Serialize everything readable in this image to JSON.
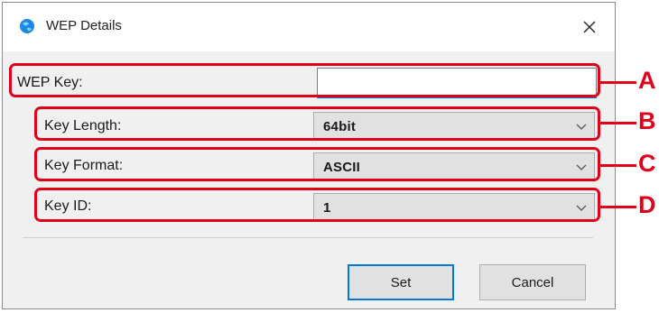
{
  "window": {
    "title": "WEP Details",
    "close_glyph": "✕",
    "app_icon": "globe-icon"
  },
  "fields": {
    "wep_key": {
      "label": "WEP Key:",
      "value": "",
      "placeholder": ""
    },
    "key_length": {
      "label": "Key Length:",
      "value": "64bit"
    },
    "key_format": {
      "label": "Key Format:",
      "value": "ASCII"
    },
    "key_id": {
      "label": "Key ID:",
      "value": "1"
    }
  },
  "buttons": {
    "set": "Set",
    "cancel": "Cancel"
  },
  "callouts": [
    "A",
    "B",
    "C",
    "D"
  ],
  "colors": {
    "annotation_red": "#e0001a",
    "focus_blue": "#0078d7"
  }
}
